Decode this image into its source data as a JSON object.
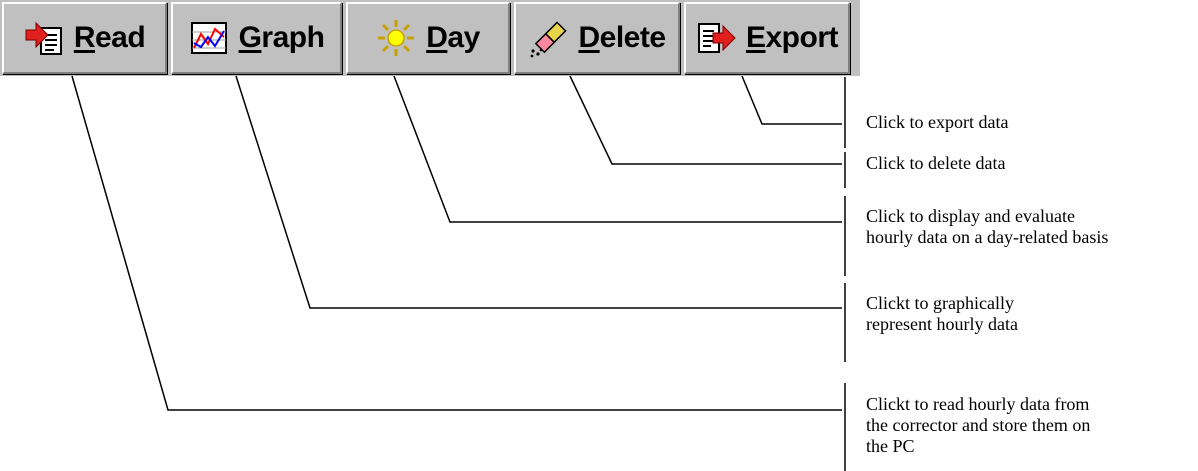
{
  "toolbar": {
    "buttons": [
      {
        "id": "read",
        "mnemonic": "R",
        "rest": "ead",
        "icon": "read-icon"
      },
      {
        "id": "graph",
        "mnemonic": "G",
        "rest": "raph",
        "icon": "graph-icon"
      },
      {
        "id": "day",
        "mnemonic": "D",
        "rest": "ay",
        "icon": "sun-icon"
      },
      {
        "id": "delete",
        "mnemonic": "D",
        "rest": "elete",
        "icon": "eraser-icon"
      },
      {
        "id": "export",
        "mnemonic": "E",
        "rest": "xport",
        "icon": "export-icon"
      }
    ]
  },
  "annotations": {
    "export": "Click to export data",
    "delete": "Click to delete data",
    "day": "Click to display and evaluate\nhourly data on a day-related basis",
    "graph": "Clickt to graphically\nrepresent hourly data",
    "read": "Clickt to read hourly data from\nthe corrector and store them on\nthe PC"
  },
  "colors": {
    "button_face": "#c0c0c0",
    "highlight": "#ffffff",
    "shadow": "#808080",
    "read_arrow": "#e0201c",
    "export_arrow": "#e0201c",
    "sun": "#ffff00",
    "graph_line_red": "#ff0000",
    "graph_line_blue": "#0000ff"
  }
}
